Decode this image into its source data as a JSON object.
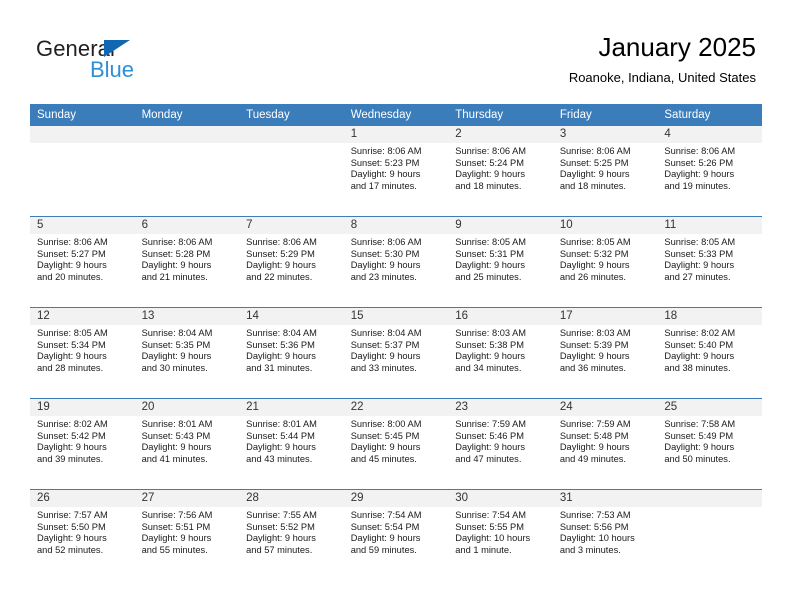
{
  "brand": {
    "name_top": "General",
    "name_bottom": "Blue",
    "triangle_color": "#1267b2",
    "blue_color": "#2f8fd4"
  },
  "header": {
    "title": "January 2025",
    "subtitle": "Roanoke, Indiana, United States",
    "header_bg": "#3b7cba",
    "dateband_bg": "#f2f2f2"
  },
  "weekdays": [
    "Sunday",
    "Monday",
    "Tuesday",
    "Wednesday",
    "Thursday",
    "Friday",
    "Saturday"
  ],
  "weeks": [
    [
      {
        "date": "",
        "lines": []
      },
      {
        "date": "",
        "lines": []
      },
      {
        "date": "",
        "lines": []
      },
      {
        "date": "1",
        "lines": [
          "Sunrise: 8:06 AM",
          "Sunset: 5:23 PM",
          "Daylight: 9 hours",
          "and 17 minutes."
        ]
      },
      {
        "date": "2",
        "lines": [
          "Sunrise: 8:06 AM",
          "Sunset: 5:24 PM",
          "Daylight: 9 hours",
          "and 18 minutes."
        ]
      },
      {
        "date": "3",
        "lines": [
          "Sunrise: 8:06 AM",
          "Sunset: 5:25 PM",
          "Daylight: 9 hours",
          "and 18 minutes."
        ]
      },
      {
        "date": "4",
        "lines": [
          "Sunrise: 8:06 AM",
          "Sunset: 5:26 PM",
          "Daylight: 9 hours",
          "and 19 minutes."
        ]
      }
    ],
    [
      {
        "date": "5",
        "lines": [
          "Sunrise: 8:06 AM",
          "Sunset: 5:27 PM",
          "Daylight: 9 hours",
          "and 20 minutes."
        ]
      },
      {
        "date": "6",
        "lines": [
          "Sunrise: 8:06 AM",
          "Sunset: 5:28 PM",
          "Daylight: 9 hours",
          "and 21 minutes."
        ]
      },
      {
        "date": "7",
        "lines": [
          "Sunrise: 8:06 AM",
          "Sunset: 5:29 PM",
          "Daylight: 9 hours",
          "and 22 minutes."
        ]
      },
      {
        "date": "8",
        "lines": [
          "Sunrise: 8:06 AM",
          "Sunset: 5:30 PM",
          "Daylight: 9 hours",
          "and 23 minutes."
        ]
      },
      {
        "date": "9",
        "lines": [
          "Sunrise: 8:05 AM",
          "Sunset: 5:31 PM",
          "Daylight: 9 hours",
          "and 25 minutes."
        ]
      },
      {
        "date": "10",
        "lines": [
          "Sunrise: 8:05 AM",
          "Sunset: 5:32 PM",
          "Daylight: 9 hours",
          "and 26 minutes."
        ]
      },
      {
        "date": "11",
        "lines": [
          "Sunrise: 8:05 AM",
          "Sunset: 5:33 PM",
          "Daylight: 9 hours",
          "and 27 minutes."
        ]
      }
    ],
    [
      {
        "date": "12",
        "lines": [
          "Sunrise: 8:05 AM",
          "Sunset: 5:34 PM",
          "Daylight: 9 hours",
          "and 28 minutes."
        ]
      },
      {
        "date": "13",
        "lines": [
          "Sunrise: 8:04 AM",
          "Sunset: 5:35 PM",
          "Daylight: 9 hours",
          "and 30 minutes."
        ]
      },
      {
        "date": "14",
        "lines": [
          "Sunrise: 8:04 AM",
          "Sunset: 5:36 PM",
          "Daylight: 9 hours",
          "and 31 minutes."
        ]
      },
      {
        "date": "15",
        "lines": [
          "Sunrise: 8:04 AM",
          "Sunset: 5:37 PM",
          "Daylight: 9 hours",
          "and 33 minutes."
        ]
      },
      {
        "date": "16",
        "lines": [
          "Sunrise: 8:03 AM",
          "Sunset: 5:38 PM",
          "Daylight: 9 hours",
          "and 34 minutes."
        ]
      },
      {
        "date": "17",
        "lines": [
          "Sunrise: 8:03 AM",
          "Sunset: 5:39 PM",
          "Daylight: 9 hours",
          "and 36 minutes."
        ]
      },
      {
        "date": "18",
        "lines": [
          "Sunrise: 8:02 AM",
          "Sunset: 5:40 PM",
          "Daylight: 9 hours",
          "and 38 minutes."
        ]
      }
    ],
    [
      {
        "date": "19",
        "lines": [
          "Sunrise: 8:02 AM",
          "Sunset: 5:42 PM",
          "Daylight: 9 hours",
          "and 39 minutes."
        ]
      },
      {
        "date": "20",
        "lines": [
          "Sunrise: 8:01 AM",
          "Sunset: 5:43 PM",
          "Daylight: 9 hours",
          "and 41 minutes."
        ]
      },
      {
        "date": "21",
        "lines": [
          "Sunrise: 8:01 AM",
          "Sunset: 5:44 PM",
          "Daylight: 9 hours",
          "and 43 minutes."
        ]
      },
      {
        "date": "22",
        "lines": [
          "Sunrise: 8:00 AM",
          "Sunset: 5:45 PM",
          "Daylight: 9 hours",
          "and 45 minutes."
        ]
      },
      {
        "date": "23",
        "lines": [
          "Sunrise: 7:59 AM",
          "Sunset: 5:46 PM",
          "Daylight: 9 hours",
          "and 47 minutes."
        ]
      },
      {
        "date": "24",
        "lines": [
          "Sunrise: 7:59 AM",
          "Sunset: 5:48 PM",
          "Daylight: 9 hours",
          "and 49 minutes."
        ]
      },
      {
        "date": "25",
        "lines": [
          "Sunrise: 7:58 AM",
          "Sunset: 5:49 PM",
          "Daylight: 9 hours",
          "and 50 minutes."
        ]
      }
    ],
    [
      {
        "date": "26",
        "lines": [
          "Sunrise: 7:57 AM",
          "Sunset: 5:50 PM",
          "Daylight: 9 hours",
          "and 52 minutes."
        ]
      },
      {
        "date": "27",
        "lines": [
          "Sunrise: 7:56 AM",
          "Sunset: 5:51 PM",
          "Daylight: 9 hours",
          "and 55 minutes."
        ]
      },
      {
        "date": "28",
        "lines": [
          "Sunrise: 7:55 AM",
          "Sunset: 5:52 PM",
          "Daylight: 9 hours",
          "and 57 minutes."
        ]
      },
      {
        "date": "29",
        "lines": [
          "Sunrise: 7:54 AM",
          "Sunset: 5:54 PM",
          "Daylight: 9 hours",
          "and 59 minutes."
        ]
      },
      {
        "date": "30",
        "lines": [
          "Sunrise: 7:54 AM",
          "Sunset: 5:55 PM",
          "Daylight: 10 hours",
          "and 1 minute."
        ]
      },
      {
        "date": "31",
        "lines": [
          "Sunrise: 7:53 AM",
          "Sunset: 5:56 PM",
          "Daylight: 10 hours",
          "and 3 minutes."
        ]
      },
      {
        "date": "",
        "lines": []
      }
    ]
  ]
}
